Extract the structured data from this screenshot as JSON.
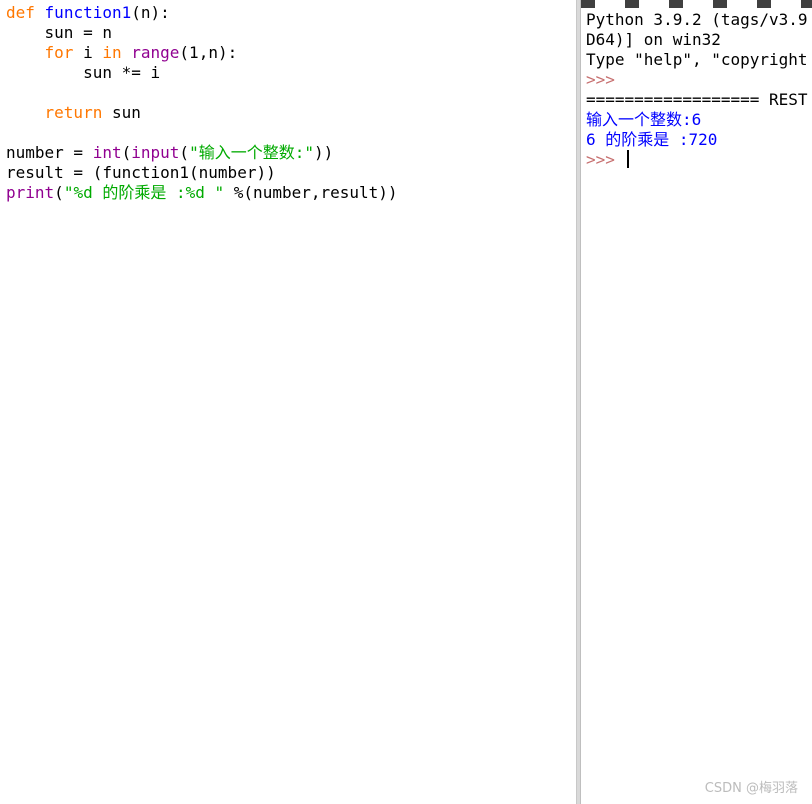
{
  "editor": {
    "lines": [
      [
        {
          "t": "def",
          "c": "kw"
        },
        {
          "t": " ",
          "c": ""
        },
        {
          "t": "function1",
          "c": "def"
        },
        {
          "t": "(n):",
          "c": ""
        }
      ],
      [
        {
          "t": "    sun = n",
          "c": ""
        }
      ],
      [
        {
          "t": "    ",
          "c": ""
        },
        {
          "t": "for",
          "c": "kw"
        },
        {
          "t": " i ",
          "c": ""
        },
        {
          "t": "in",
          "c": "kw"
        },
        {
          "t": " ",
          "c": ""
        },
        {
          "t": "range",
          "c": "builtin"
        },
        {
          "t": "(1,n):",
          "c": ""
        }
      ],
      [
        {
          "t": "        sun *= i",
          "c": ""
        }
      ],
      [],
      [
        {
          "t": "    ",
          "c": ""
        },
        {
          "t": "return",
          "c": "kw"
        },
        {
          "t": " sun",
          "c": ""
        }
      ],
      [],
      [
        {
          "t": "number = ",
          "c": ""
        },
        {
          "t": "int",
          "c": "builtin"
        },
        {
          "t": "(",
          "c": ""
        },
        {
          "t": "input",
          "c": "builtin"
        },
        {
          "t": "(",
          "c": ""
        },
        {
          "t": "\"输入一个整数:\"",
          "c": "str"
        },
        {
          "t": "))",
          "c": ""
        }
      ],
      [
        {
          "t": "result = (function1(number))",
          "c": ""
        }
      ],
      [
        {
          "t": "print",
          "c": "builtin"
        },
        {
          "t": "(",
          "c": ""
        },
        {
          "t": "\"%d 的阶乘是 :%d \"",
          "c": "str"
        },
        {
          "t": " %(number,result))",
          "c": ""
        }
      ]
    ]
  },
  "shell": {
    "lines": [
      [
        {
          "t": "Python 3.9.2 (tags/v3.9",
          "c": ""
        }
      ],
      [
        {
          "t": "D64)] on win32",
          "c": ""
        }
      ],
      [
        {
          "t": "Type \"help\", \"copyright",
          "c": ""
        }
      ],
      [
        {
          "t": ">>>",
          "c": "prompt"
        }
      ],
      [
        {
          "t": "================== REST",
          "c": ""
        }
      ],
      [
        {
          "t": "输入一个整数:6",
          "c": "out"
        }
      ],
      [
        {
          "t": "6 的阶乘是 :720",
          "c": "out"
        }
      ],
      [
        {
          "t": ">>>",
          "c": "prompt"
        },
        {
          "t": " ",
          "c": ""
        },
        {
          "t": "",
          "c": "cursor"
        }
      ]
    ]
  },
  "watermark": "CSDN @梅羽落"
}
